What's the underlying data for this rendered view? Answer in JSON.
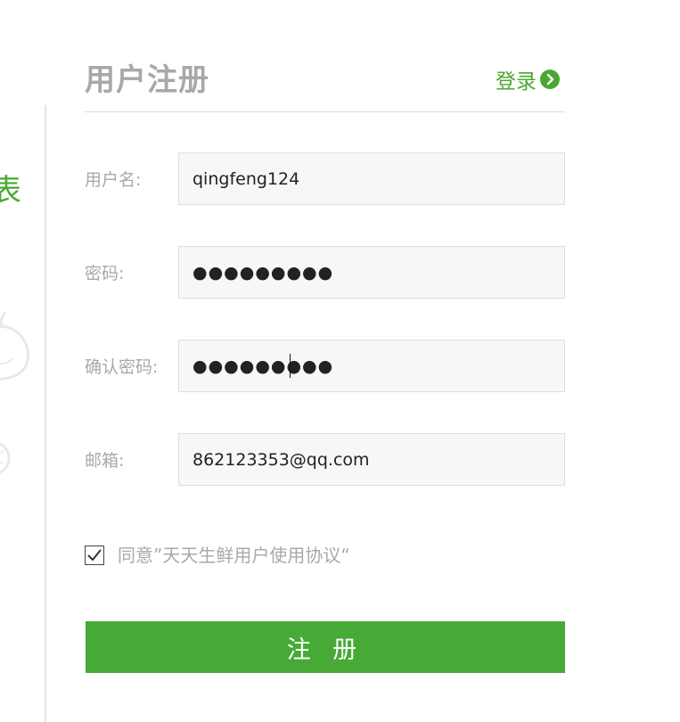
{
  "page": {
    "title": "用户注册"
  },
  "header": {
    "login_label": "登录"
  },
  "form": {
    "username": {
      "label": "用户名:",
      "value": "qingfeng124"
    },
    "password": {
      "label": "密码:",
      "value": "●●●●●●●●●"
    },
    "confirm_password": {
      "label": "确认密码:",
      "value": "●●●●●●●●●"
    },
    "email": {
      "label": "邮箱:",
      "value": "862123353@qq.com"
    },
    "agreement": {
      "checked": true,
      "text": "同意”天天生鲜用户使用协议“"
    },
    "submit_label": "注 册"
  },
  "decor": {
    "left_glyph": "表"
  },
  "colors": {
    "accent": "#47aa36",
    "title_gray": "#a8a8a8",
    "label_gray": "#a9a9a9",
    "input_bg": "#f7f7f7",
    "input_border": "#dedede"
  },
  "icons": {
    "login_arrow": "chevron-right-circle-icon",
    "agreement_check": "checkmark-icon"
  }
}
